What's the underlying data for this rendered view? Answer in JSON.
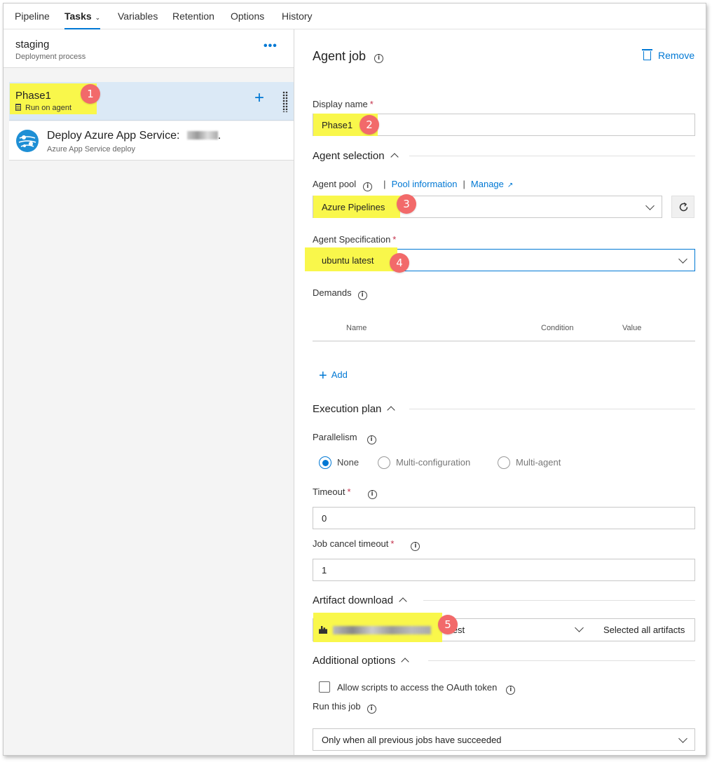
{
  "nav": {
    "tabs": [
      {
        "label": "Pipeline"
      },
      {
        "label": "Tasks"
      },
      {
        "label": "Variables"
      },
      {
        "label": "Retention"
      },
      {
        "label": "Options"
      },
      {
        "label": "History"
      }
    ],
    "active_tab": "Tasks"
  },
  "stage": {
    "title": "staging",
    "subtitle": "Deployment process",
    "more_label": "•••"
  },
  "phase": {
    "title": "Phase1",
    "subtitle": "Run on agent",
    "badge": "1"
  },
  "task": {
    "title": "Deploy Azure App Service: ",
    "title_suffix": ".",
    "subtitle": "Azure App Service deploy"
  },
  "agent_job": {
    "heading": "Agent job",
    "remove_label": "Remove",
    "display_name_label": "Display name",
    "display_name_value": "Phase1",
    "display_name_badge": "2",
    "agent_selection_label": "Agent selection",
    "agent_pool_label": "Agent pool",
    "pool_information_link": "Pool information",
    "manage_link": "Manage",
    "agent_pool_value": "Azure Pipelines",
    "agent_pool_badge": "3",
    "agent_spec_label": "Agent Specification",
    "agent_spec_value": "ubuntu latest",
    "agent_spec_badge": "4",
    "demands_label": "Demands",
    "demands_columns": [
      "Name",
      "Condition",
      "Value"
    ],
    "add_label": "Add",
    "execution_plan_label": "Execution plan",
    "parallelism_label": "Parallelism",
    "parallelism_options": [
      "None",
      "Multi-configuration",
      "Multi-agent"
    ],
    "parallelism_selected": "None",
    "timeout_label": "Timeout",
    "timeout_value": "0",
    "job_cancel_timeout_label": "Job cancel timeout",
    "job_cancel_timeout_value": "1",
    "artifact_download_label": "Artifact download",
    "artifact_version": "latest",
    "artifact_selection": "Selected all artifacts",
    "artifact_badge": "5",
    "additional_options_label": "Additional options",
    "oauth_label": "Allow scripts to access the OAuth token",
    "oauth_checked": false,
    "run_this_job_label": "Run this job",
    "run_this_job_value": "Only when all previous jobs have succeeded"
  },
  "colors": {
    "accent": "#0078d4",
    "highlight": "#f9f74b",
    "badge": "#f26a6a",
    "required": "#c4314b"
  }
}
